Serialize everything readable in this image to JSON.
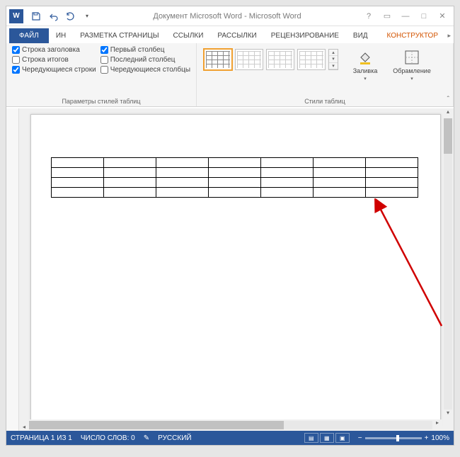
{
  "title": "Документ Microsoft Word - Microsoft Word",
  "tabs": {
    "file": "ФАЙЛ",
    "hidden": "ИН",
    "page_layout": "РАЗМЕТКА СТРАНИЦЫ",
    "references": "ССЫЛКИ",
    "mailings": "РАССЫЛКИ",
    "review": "РЕЦЕНЗИРОВАНИЕ",
    "view": "ВИД",
    "constructor": "КОНСТРУКТОР"
  },
  "ribbon": {
    "style_opts_label": "Параметры стилей таблиц",
    "styles_label": "Стили таблиц",
    "opt": {
      "header_row": "Строка заголовка",
      "total_row": "Строка итогов",
      "banded_rows": "Чередующиеся строки",
      "first_col": "Первый столбец",
      "last_col": "Последний столбец",
      "banded_cols": "Чередующиеся столбцы"
    },
    "opt_state": {
      "header_row": true,
      "total_row": false,
      "banded_rows": true,
      "first_col": true,
      "last_col": false,
      "banded_cols": false
    },
    "shading": "Заливка",
    "borders": "Обрамление"
  },
  "statusbar": {
    "page": "СТРАНИЦА 1 ИЗ 1",
    "words": "ЧИСЛО СЛОВ: 0",
    "lang": "РУССКИЙ",
    "zoom": "100%"
  },
  "table": {
    "rows": 4,
    "cols": 7
  }
}
